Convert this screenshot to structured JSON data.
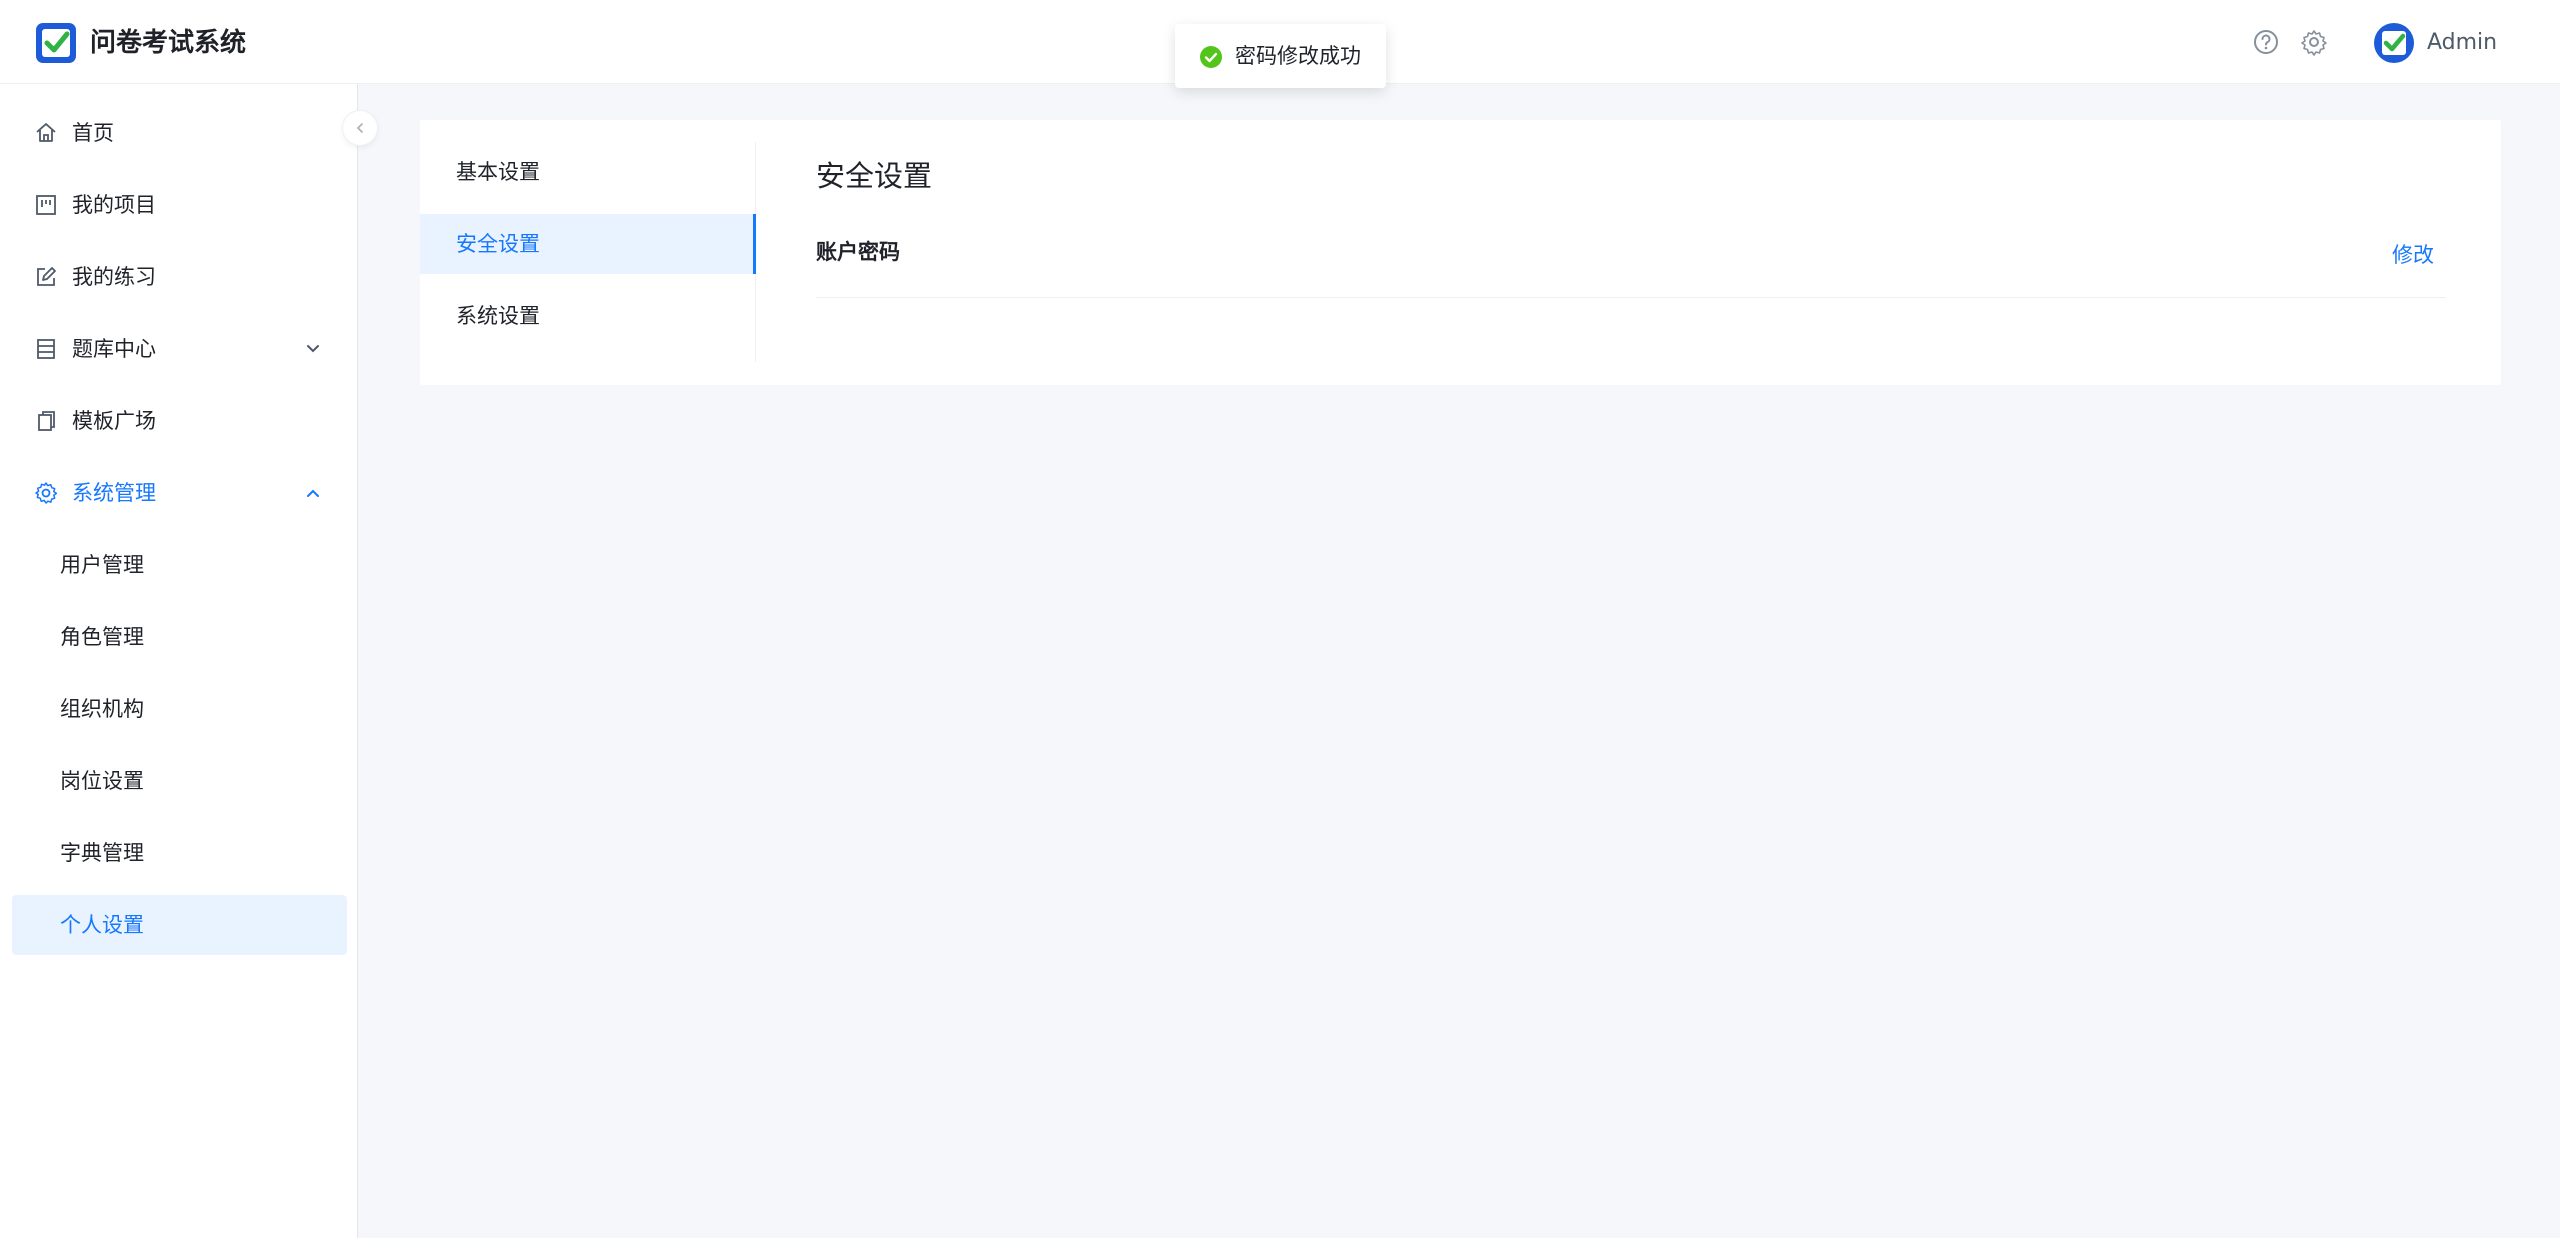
{
  "app": {
    "title": "问卷考试系统",
    "user_name": "Admin"
  },
  "header": {
    "icons": [
      "help-circle-icon",
      "gear-icon"
    ]
  },
  "toast": {
    "message": "密码修改成功",
    "icon": "check-circle-icon",
    "color": "#52c41a"
  },
  "sidebar": {
    "items": [
      {
        "label": "首页",
        "icon": "home-icon"
      },
      {
        "label": "我的项目",
        "icon": "project-icon"
      },
      {
        "label": "我的练习",
        "icon": "edit-icon"
      },
      {
        "label": "题库中心",
        "icon": "database-icon",
        "expanded": false
      },
      {
        "label": "模板广场",
        "icon": "copy-icon"
      },
      {
        "label": "系统管理",
        "icon": "gear-icon",
        "expanded": true
      }
    ],
    "subitems": [
      {
        "label": "用户管理"
      },
      {
        "label": "角色管理"
      },
      {
        "label": "组织机构"
      },
      {
        "label": "岗位设置"
      },
      {
        "label": "字典管理"
      },
      {
        "label": "个人设置",
        "active": true
      }
    ]
  },
  "settings": {
    "tabs": [
      {
        "label": "基本设置"
      },
      {
        "label": "安全设置",
        "active": true
      },
      {
        "label": "系统设置"
      }
    ],
    "section_title": "安全设置",
    "rows": [
      {
        "label": "账户密码",
        "action": "修改"
      }
    ]
  },
  "colors": {
    "primary": "#1677ff",
    "active_bg": "#e8f3ff",
    "success": "#52c41a"
  }
}
